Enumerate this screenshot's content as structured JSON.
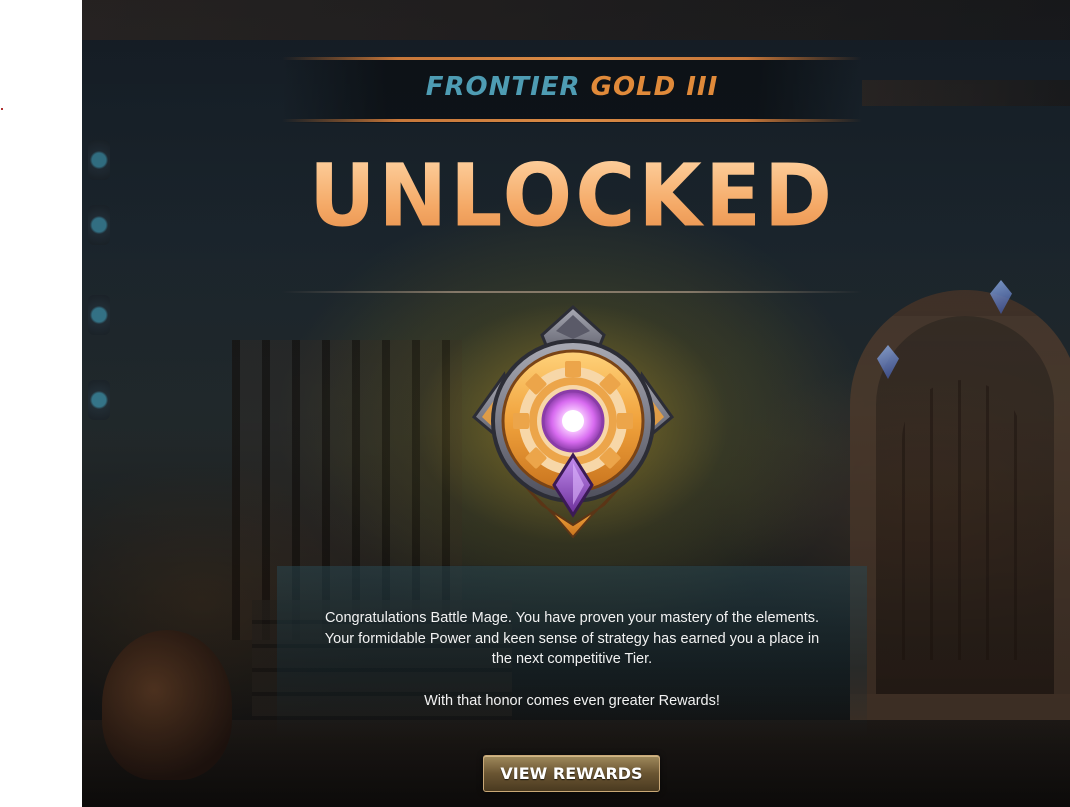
{
  "tier": {
    "league": "FRONTIER",
    "rank": "GOLD III"
  },
  "headline": "UNLOCKED",
  "badge": {
    "icon": "gold-tier-emblem-icon"
  },
  "message": {
    "paragraph": "Congratulations Battle Mage. You have proven your mastery of the elements. Your formidable Power and keen sense of strategy has earned you a place in the next competitive Tier.",
    "closing": "With that honor comes even greater Rewards!"
  },
  "button": {
    "label": "VIEW REWARDS"
  },
  "colors": {
    "league": "#4e9cb3",
    "rank": "#e08a3a",
    "headline": "#f6b877",
    "rule": "#c7773a",
    "badge_core": "#d86bf0"
  }
}
